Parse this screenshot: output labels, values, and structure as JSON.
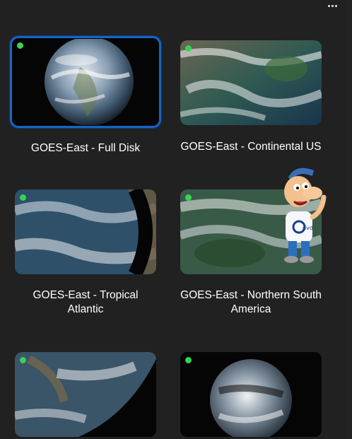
{
  "toolbar": {
    "more_icon": "more-horizontal-icon"
  },
  "colors": {
    "selection": "#1565c0",
    "status": "#39d353",
    "background": "#212121"
  },
  "streams": [
    {
      "title": "GOES-East - Full Disk",
      "selected": true,
      "status": "live"
    },
    {
      "title": "GOES-East - Continental US",
      "selected": false,
      "status": "live"
    },
    {
      "title": "GOES-East - Tropical Atlantic",
      "selected": false,
      "status": "live"
    },
    {
      "title": "GOES-East - Northern South America",
      "selected": false,
      "status": "live"
    },
    {
      "title": "",
      "selected": false,
      "status": "live"
    },
    {
      "title": "",
      "selected": false,
      "status": "live"
    }
  ],
  "watermark": {
    "text": "dvd"
  }
}
